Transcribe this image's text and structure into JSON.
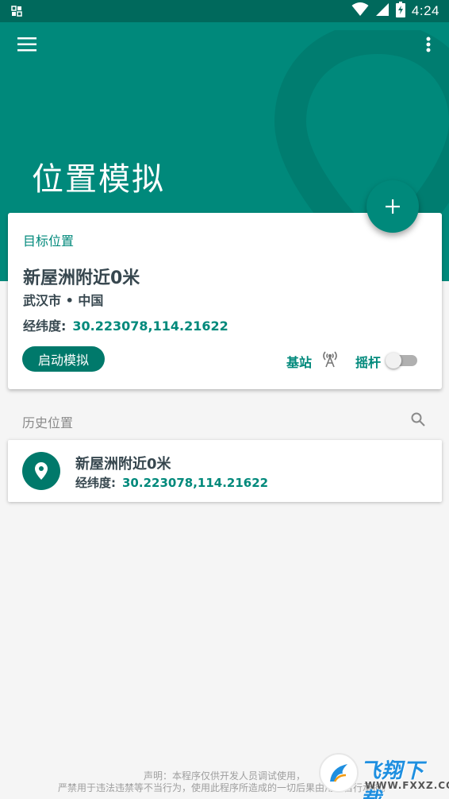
{
  "status_bar": {
    "time": "4:24",
    "icons": [
      "notification-icon",
      "wifi-icon",
      "signal-icon",
      "battery-icon"
    ]
  },
  "app_bar": {
    "title": "位置模拟",
    "color": "#00897b",
    "icons": [
      "menu-icon",
      "more-vert-icon"
    ]
  },
  "fab": {
    "icon": "add-icon"
  },
  "target": {
    "section_label": "目标位置",
    "location_name": "新屋洲附近0米",
    "city": "武汉市 • 中国",
    "coords_label": "经纬度:",
    "coords_value": "30.223078,114.21622",
    "start_button": "启动模拟",
    "base_station_label": "基站",
    "base_station_icon": "cell-tower-icon",
    "joystick_label": "摇杆",
    "joystick_enabled": false
  },
  "history": {
    "header": "历史位置",
    "search_icon": "search-icon",
    "items": [
      {
        "name": "新屋洲附近0米",
        "coords_label": "经纬度:",
        "coords_value": "30.223078,114.21622",
        "icon": "location-pin-icon"
      }
    ]
  },
  "disclaimer": {
    "line1": "声明：本程序仅供开发人员调试使用，",
    "line2": "严禁用于违法违禁等不当行为，使用此程序所造成的一切后果由用户自行承担。"
  },
  "watermark": {
    "logo_text": "飞翔下载",
    "url": "WWW.FXXZ.COM"
  },
  "colors": {
    "primary": "#00897b",
    "primary_dark": "#00695c",
    "button": "#00796b",
    "text_dark": "#37474f",
    "text_muted": "#8a8a8a",
    "background": "#f5f5f5"
  }
}
